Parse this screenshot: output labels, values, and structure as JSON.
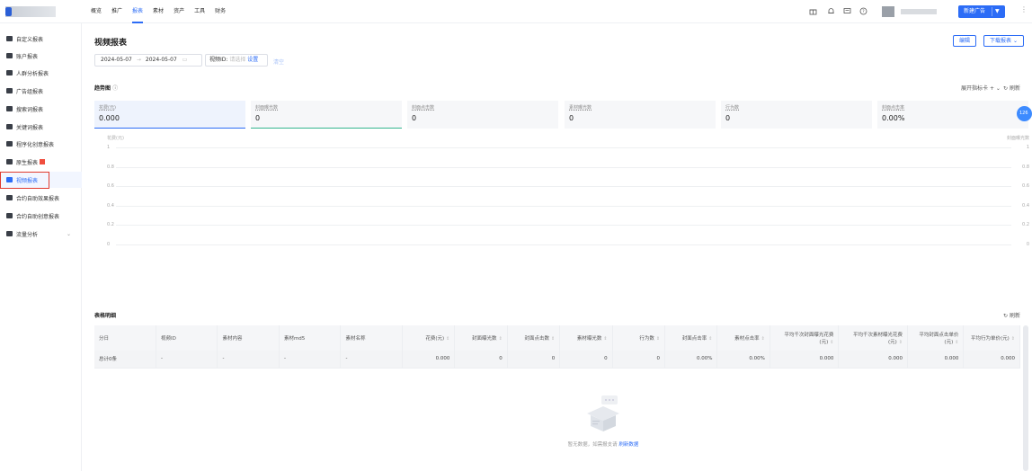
{
  "nav": {
    "items": [
      "概览",
      "推广",
      "报表",
      "素材",
      "资产",
      "工具",
      "财务"
    ],
    "active_index": 2
  },
  "topbar": {
    "new_ad_label": "新建广告",
    "icons": [
      "gift-icon",
      "bell-icon",
      "message-icon",
      "help-icon"
    ]
  },
  "sidebar": {
    "items": [
      {
        "label": "自定义报表"
      },
      {
        "label": "账户报表"
      },
      {
        "label": "人群分析报表"
      },
      {
        "label": "广告组报表"
      },
      {
        "label": "搜索词报表"
      },
      {
        "label": "关键词报表"
      },
      {
        "label": "程序化创意报表"
      },
      {
        "label": "原生报表"
      },
      {
        "label": "视频报表",
        "active": true
      },
      {
        "label": "合约自助效果报表"
      },
      {
        "label": "合约自助创意报表"
      },
      {
        "label": "流量分析"
      }
    ]
  },
  "page": {
    "title": "视频报表",
    "edit_label": "编辑",
    "download_label": "下载报表",
    "date_start": "2024-05-07",
    "date_end": "2024-05-07",
    "video_id_label": "视频ID:",
    "video_id_placeholder": "请选择",
    "set_label": "设置",
    "clear_label": "清空"
  },
  "trend": {
    "title": "趋势图",
    "expand_label": "展开指标卡",
    "refresh_label": "刷新",
    "cards": [
      {
        "label": "花费(元)",
        "value": "0.000"
      },
      {
        "label": "封面曝光数",
        "value": "0"
      },
      {
        "label": "封面点击数",
        "value": "0"
      },
      {
        "label": "素材曝光数",
        "value": "0"
      },
      {
        "label": "行为数",
        "value": "0"
      },
      {
        "label": "封面点击率",
        "value": "0.00%"
      }
    ],
    "badge": "126"
  },
  "chart_data": {
    "type": "line",
    "left_axis_label": "花费(元)",
    "right_axis_label": "封面曝光数",
    "y_ticks": [
      "1",
      "0.8",
      "0.6",
      "0.4",
      "0.2",
      "0"
    ],
    "ylim": [
      0,
      1
    ],
    "series": []
  },
  "table": {
    "title": "表格明细",
    "refresh_label": "刷新",
    "headers": [
      "分日",
      "视频ID",
      "素材内容",
      "素材md5",
      "素材名称",
      "花费(元)",
      "封面曝光数",
      "封面点击数",
      "素材曝光数",
      "行为数",
      "封面点击率",
      "素材点击率",
      "平均千次封面曝光花费(元)",
      "平均千次素材曝光花费(元)",
      "平均封面点击单价(元)",
      "平均行为单价(元)"
    ],
    "total_row": [
      "总计0条",
      "-",
      "-",
      "-",
      "-",
      "0.000",
      "0",
      "0",
      "0",
      "0",
      "0.00%",
      "0.00%",
      "0.000",
      "0.000",
      "0.000",
      "0.000"
    ],
    "empty_text": "暂无数据，如需报支请",
    "empty_link": "刷新数据"
  }
}
